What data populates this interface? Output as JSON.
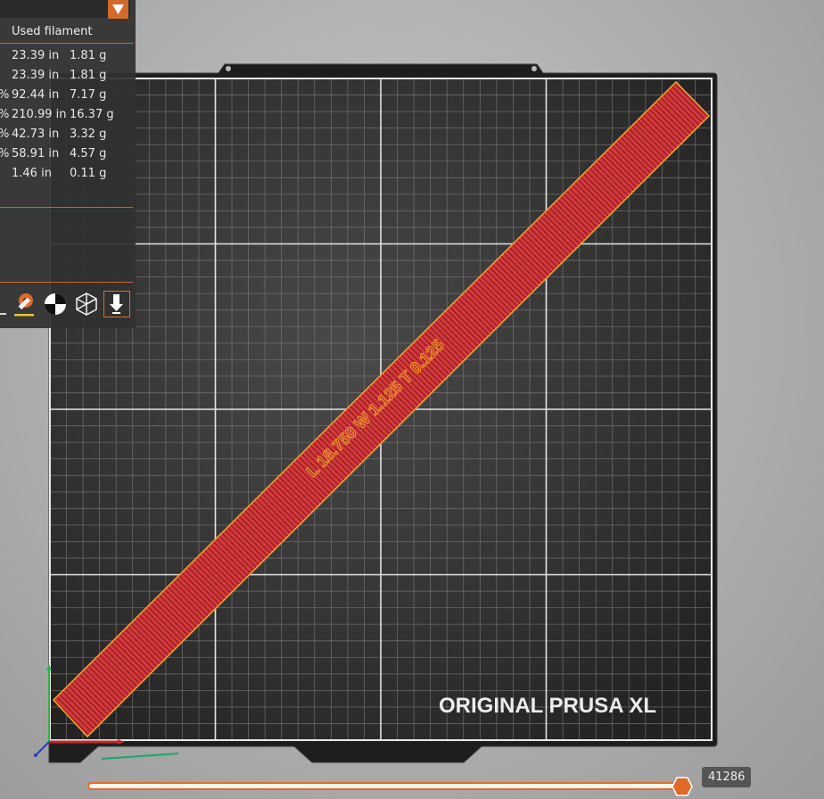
{
  "legend": {
    "header": "Used filament",
    "rows": [
      {
        "pct": "",
        "length": "23.39 in",
        "weight": "1.81 g"
      },
      {
        "pct": "",
        "length": "23.39 in",
        "weight": "1.81 g"
      },
      {
        "pct": "%",
        "length": "92.44 in",
        "weight": "7.17 g"
      },
      {
        "pct": "%",
        "length": "210.99 in",
        "weight": "16.37 g"
      },
      {
        "pct": "%",
        "length": "42.73 in",
        "weight": "3.32 g"
      },
      {
        "pct": "%",
        "length": "58.91 in",
        "weight": "4.57 g"
      },
      {
        "pct": "",
        "length": "1.46 in",
        "weight": "0.11 g"
      }
    ]
  },
  "bed": {
    "brand_text": "ORIGINAL PRUSA XL",
    "part_label": "L 18.750 W 1.125 T 0.125"
  },
  "toolbar": {
    "icons": [
      "paint-brush-icon",
      "sphere-half-icon",
      "wireframe-cube-icon",
      "download-arrow-icon"
    ]
  },
  "slider": {
    "value": "41286",
    "position_fraction": 0.99
  },
  "colors": {
    "accent": "#e06a2a",
    "part": "#d0393b",
    "bed": "#2e2e2e",
    "grid": "#8a8a8a"
  }
}
